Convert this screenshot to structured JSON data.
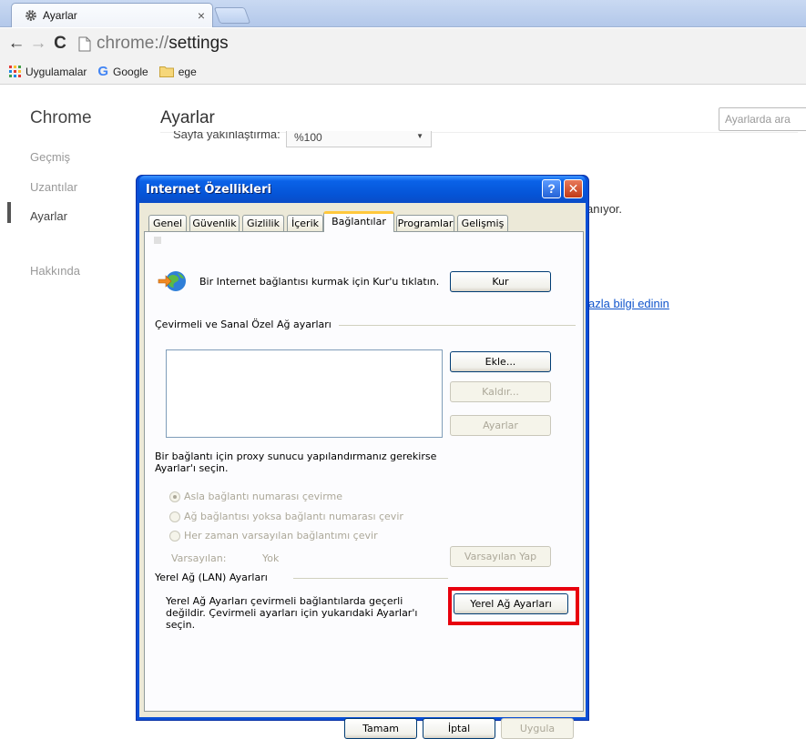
{
  "browser": {
    "tab_title": "Ayarlar",
    "tab_close": "×",
    "address_scheme": "chrome://",
    "address_host": "settings",
    "bookmarks": [
      {
        "label": "Uygulamalar",
        "icon": "apps-grid-icon"
      },
      {
        "label": "Google",
        "icon": "google-g-icon"
      },
      {
        "label": "ege",
        "icon": "folder-icon"
      }
    ]
  },
  "settings": {
    "sidebar_title": "Chrome",
    "sidebar_items": [
      "Geçmiş",
      "Uzantılar",
      "Ayarlar",
      "Hakkında"
    ],
    "page_title": "Ayarlar",
    "search_placeholder": "Ayarlarda ara",
    "zoom_label": "Sayfa yakınlaştırma:",
    "zoom_value": "%100",
    "partial_text_1": "anıyor.",
    "partial_link_1": "azla bilgi edinin"
  },
  "dialog": {
    "title": "Internet Özellikleri",
    "help_glyph": "?",
    "close_glyph": "✕",
    "tabs": [
      "Genel",
      "Güvenlik",
      "Gizlilik",
      "İçerik",
      "Bağlantılar",
      "Programlar",
      "Gelişmiş"
    ],
    "selected_tab": "Bağlantılar",
    "setup_text": "Bir Internet bağlantısı kurmak için Kur'u tıklatın.",
    "setup_button": "Kur",
    "dialup_section": "Çevirmeli ve Sanal Özel Ağ ayarları",
    "add_button": "Ekle...",
    "remove_button": "Kaldır...",
    "settings_button": "Ayarlar",
    "proxy_text": "Bir bağlantı için proxy sunucu yapılandırmanız gerekirse Ayarlar'ı seçin.",
    "radio_options": [
      "Asla bağlantı numarası çevirme",
      "Ağ bağlantısı yoksa bağlantı numarası çevir",
      "Her zaman varsayılan bağlantımı çevir"
    ],
    "selected_radio": 0,
    "default_label": "Varsayılan:",
    "default_value": "Yok",
    "set_default_button": "Varsayılan Yap",
    "lan_section": "Yerel Ağ (LAN) Ayarları",
    "lan_text": "Yerel Ağ Ayarları çevirmeli bağlantılarda geçerli değildir. Çevirmeli ayarları için yukarıdaki Ayarlar'ı seçin.",
    "lan_button": "Yerel Ağ Ayarları",
    "ok_button": "Tamam",
    "cancel_button": "İptal",
    "apply_button": "Uygula"
  },
  "colors": {
    "xp_title_blue": "#0554d6",
    "highlight_red": "#e8000e",
    "dialog_face": "#ece9d8"
  }
}
